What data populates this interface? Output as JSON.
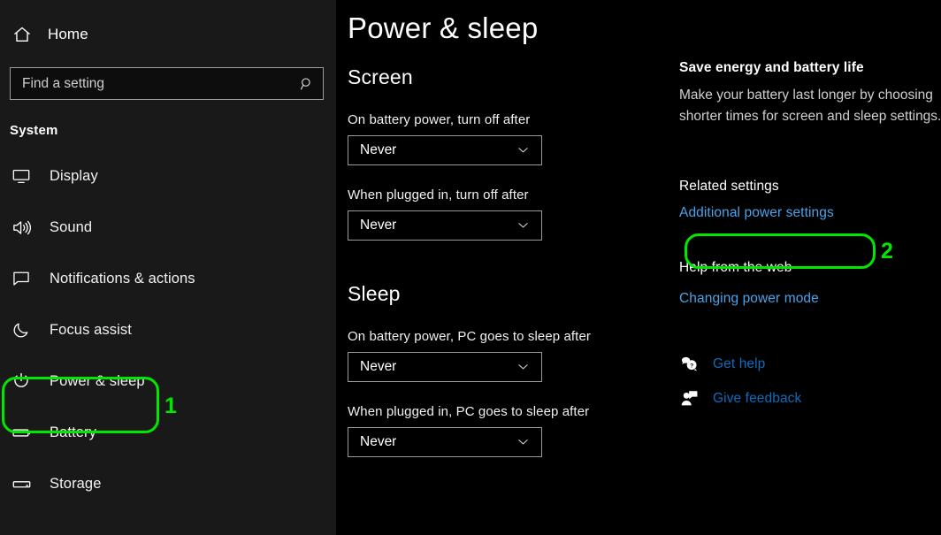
{
  "sidebar": {
    "home": {
      "label": "Home",
      "icon": "home-icon"
    },
    "search": {
      "placeholder": "Find a setting",
      "value": "",
      "icon": "search-icon"
    },
    "section_title": "System",
    "items": [
      {
        "label": "Display",
        "icon": "monitor-icon",
        "selected": false
      },
      {
        "label": "Sound",
        "icon": "speaker-icon",
        "selected": false
      },
      {
        "label": "Notifications & actions",
        "icon": "speech-bubble-icon",
        "selected": false
      },
      {
        "label": "Focus assist",
        "icon": "crescent-moon-icon",
        "selected": false
      },
      {
        "label": "Power & sleep",
        "icon": "power-icon",
        "selected": true
      },
      {
        "label": "Battery",
        "icon": "battery-icon",
        "selected": false
      },
      {
        "label": "Storage",
        "icon": "storage-icon",
        "selected": false
      }
    ]
  },
  "main": {
    "page_title": "Power & sleep",
    "groups": [
      {
        "title": "Screen",
        "fields": [
          {
            "label": "On battery power, turn off after",
            "value": "Never"
          },
          {
            "label": "When plugged in, turn off after",
            "value": "Never"
          }
        ]
      },
      {
        "title": "Sleep",
        "fields": [
          {
            "label": "On battery power, PC goes to sleep after",
            "value": "Never"
          },
          {
            "label": "When plugged in, PC goes to sleep after",
            "value": "Never"
          }
        ]
      }
    ]
  },
  "aside": {
    "promo_title": "Save energy and battery life",
    "promo_body": "Make your battery last longer by choosing shorter times for screen and sleep settings.",
    "related_title": "Related settings",
    "related_link": "Additional power settings",
    "help_title": "Help from the web",
    "help_link": "Changing power mode",
    "support": [
      {
        "label": "Get help",
        "icon": "question-bubble-icon"
      },
      {
        "label": "Give feedback",
        "icon": "feedback-person-icon"
      }
    ]
  },
  "annotations": {
    "color": "#00e800",
    "markers": [
      {
        "number": "1",
        "target": "sidebar-item-power-sleep"
      },
      {
        "number": "2",
        "target": "additional-power-settings-link"
      }
    ]
  }
}
